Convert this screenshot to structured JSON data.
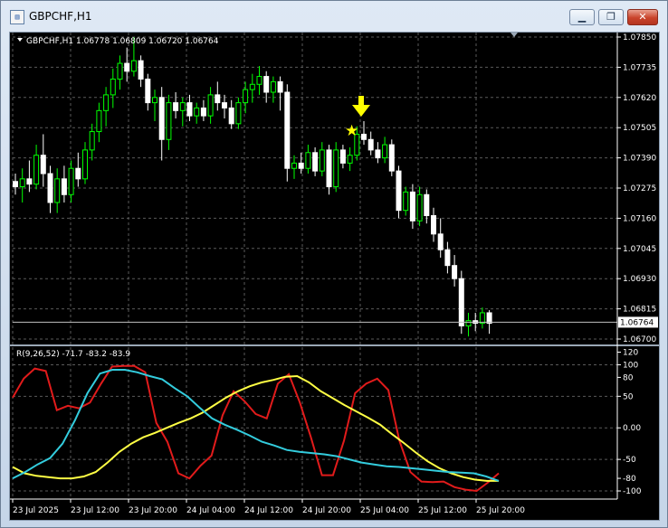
{
  "window": {
    "title": "GBPCHF,H1"
  },
  "chart": {
    "header": "GBPCHF,H1  1.06778 1.06809 1.06720 1.06764",
    "price_labels": [
      "1.07850",
      "1.07735",
      "1.07620",
      "1.07505",
      "1.07390",
      "1.07275",
      "1.07160",
      "1.07045",
      "1.06930",
      "1.06815",
      "1.06700"
    ],
    "current_price": "1.06764",
    "colors": {
      "background": "#000000",
      "bull": "#00ff00",
      "bear": "#ffffff",
      "arrow": "#ffff00",
      "star": "#ffff00"
    }
  },
  "indicator": {
    "header": "R(9,26,52) -71.7 -83.2 -83.9",
    "scale_labels": [
      "120",
      "100",
      "80",
      "50",
      "0.00",
      "-50",
      "-80",
      "-100"
    ],
    "colors": {
      "fast": "#e11b1b",
      "mid": "#ffff44",
      "slow": "#33ccdd"
    }
  },
  "time_labels": [
    "23 Jul 2025",
    "23 Jul 12:00",
    "23 Jul 20:00",
    "24 Jul 04:00",
    "24 Jul 12:00",
    "24 Jul 20:00",
    "25 Jul 04:00",
    "25 Jul 12:00",
    "25 Jul 20:00"
  ],
  "chart_data": {
    "type": "candlestick",
    "symbol": "GBPCHF",
    "timeframe": "H1",
    "ylim": [
      1.067,
      1.0785
    ],
    "candles": [
      [
        1.073,
        1.0733,
        1.0725,
        1.0728
      ],
      [
        1.0728,
        1.0735,
        1.0722,
        1.0731
      ],
      [
        1.0731,
        1.0738,
        1.0726,
        1.0729
      ],
      [
        1.0729,
        1.0744,
        1.0727,
        1.074
      ],
      [
        1.074,
        1.0748,
        1.0728,
        1.0733
      ],
      [
        1.0733,
        1.0736,
        1.0718,
        1.0722
      ],
      [
        1.0722,
        1.0735,
        1.0718,
        1.0731
      ],
      [
        1.0731,
        1.0736,
        1.0722,
        1.0725
      ],
      [
        1.0725,
        1.0738,
        1.0722,
        1.0735
      ],
      [
        1.0735,
        1.0741,
        1.0728,
        1.0731
      ],
      [
        1.0731,
        1.0745,
        1.0729,
        1.0742
      ],
      [
        1.0742,
        1.0752,
        1.0738,
        1.0749
      ],
      [
        1.0749,
        1.076,
        1.0745,
        1.0757
      ],
      [
        1.0757,
        1.0766,
        1.0751,
        1.0763
      ],
      [
        1.0763,
        1.0773,
        1.0758,
        1.0769
      ],
      [
        1.0769,
        1.0778,
        1.0765,
        1.0775
      ],
      [
        1.0775,
        1.0781,
        1.0768,
        1.0772
      ],
      [
        1.0772,
        1.0785,
        1.077,
        1.0776
      ],
      [
        1.0776,
        1.0778,
        1.0766,
        1.0769
      ],
      [
        1.0769,
        1.0771,
        1.0757,
        1.076
      ],
      [
        1.076,
        1.0765,
        1.0753,
        1.0762
      ],
      [
        1.0762,
        1.0766,
        1.0738,
        1.0746
      ],
      [
        1.0746,
        1.0763,
        1.0742,
        1.076
      ],
      [
        1.076,
        1.0764,
        1.0754,
        1.0757
      ],
      [
        1.0757,
        1.0762,
        1.0751,
        1.076
      ],
      [
        1.076,
        1.0763,
        1.0753,
        1.0755
      ],
      [
        1.0755,
        1.076,
        1.0752,
        1.0758
      ],
      [
        1.0758,
        1.0761,
        1.0753,
        1.0755
      ],
      [
        1.0755,
        1.0766,
        1.0752,
        1.0763
      ],
      [
        1.0763,
        1.0768,
        1.0757,
        1.076
      ],
      [
        1.076,
        1.0763,
        1.0754,
        1.0758
      ],
      [
        1.0758,
        1.0761,
        1.075,
        1.0752
      ],
      [
        1.0752,
        1.0762,
        1.075,
        1.076
      ],
      [
        1.076,
        1.0768,
        1.0756,
        1.0765
      ],
      [
        1.0765,
        1.0771,
        1.076,
        1.0767
      ],
      [
        1.0767,
        1.0774,
        1.0763,
        1.077
      ],
      [
        1.077,
        1.0772,
        1.076,
        1.0764
      ],
      [
        1.0764,
        1.077,
        1.076,
        1.0768
      ],
      [
        1.0768,
        1.077,
        1.0757,
        1.0764
      ],
      [
        1.0764,
        1.0767,
        1.073,
        1.0735
      ],
      [
        1.0735,
        1.074,
        1.0731,
        1.0737
      ],
      [
        1.0737,
        1.0741,
        1.0733,
        1.0735
      ],
      [
        1.0735,
        1.0744,
        1.0733,
        1.0741
      ],
      [
        1.0741,
        1.0743,
        1.0732,
        1.0734
      ],
      [
        1.0734,
        1.0745,
        1.0732,
        1.0742
      ],
      [
        1.0742,
        1.0744,
        1.0725,
        1.0728
      ],
      [
        1.0728,
        1.0745,
        1.0726,
        1.0742
      ],
      [
        1.0742,
        1.0744,
        1.0735,
        1.0737
      ],
      [
        1.0737,
        1.0743,
        1.0734,
        1.074
      ],
      [
        1.074,
        1.0751,
        1.0738,
        1.0748
      ],
      [
        1.0748,
        1.0753,
        1.0744,
        1.0746
      ],
      [
        1.0746,
        1.0749,
        1.074,
        1.0742
      ],
      [
        1.0742,
        1.0745,
        1.0737,
        1.0739
      ],
      [
        1.0739,
        1.0747,
        1.0737,
        1.0744
      ],
      [
        1.0744,
        1.0746,
        1.0732,
        1.0734
      ],
      [
        1.0734,
        1.0736,
        1.0716,
        1.0719
      ],
      [
        1.0719,
        1.0728,
        1.0717,
        1.0726
      ],
      [
        1.0726,
        1.0729,
        1.0712,
        1.0715
      ],
      [
        1.0715,
        1.0728,
        1.0713,
        1.0725
      ],
      [
        1.0725,
        1.0727,
        1.0714,
        1.0717
      ],
      [
        1.0717,
        1.072,
        1.0707,
        1.071
      ],
      [
        1.071,
        1.0716,
        1.0701,
        1.0704
      ],
      [
        1.0704,
        1.0707,
        1.0695,
        1.0698
      ],
      [
        1.0698,
        1.0702,
        1.069,
        1.0693
      ],
      [
        1.0693,
        1.0696,
        1.0672,
        1.0675
      ],
      [
        1.0675,
        1.068,
        1.0671,
        1.0677
      ],
      [
        1.0677,
        1.068,
        1.0673,
        1.0676
      ],
      [
        1.0676,
        1.0682,
        1.0674,
        1.068
      ],
      [
        1.068,
        1.0681,
        1.0672,
        1.0676
      ]
    ],
    "indicator": {
      "name": "R(9,26,52)",
      "ylim": [
        -110,
        125
      ],
      "series": [
        {
          "name": "9",
          "values": [
            48,
            78,
            94,
            90,
            28,
            35,
            31,
            40,
            70,
            97,
            98,
            98,
            88,
            8,
            -22,
            -72,
            -80,
            -60,
            -44,
            20,
            58,
            42,
            22,
            15,
            70,
            85,
            40,
            -15,
            -75,
            -75,
            -20,
            55,
            70,
            78,
            60,
            -20,
            -70,
            -85,
            -86,
            -85,
            -94,
            -98,
            -100,
            -87,
            -72
          ]
        },
        {
          "name": "26",
          "values": [
            -62,
            -72,
            -76,
            -78,
            -80,
            -80,
            -77,
            -70,
            -55,
            -38,
            -25,
            -15,
            -8,
            0,
            8,
            15,
            24,
            36,
            48,
            58,
            66,
            72,
            76,
            81,
            82,
            72,
            58,
            47,
            36,
            26,
            16,
            5,
            -10,
            -24,
            -39,
            -53,
            -64,
            -72,
            -78,
            -82,
            -84,
            -84
          ]
        },
        {
          "name": "52",
          "values": [
            -80,
            -70,
            -58,
            -48,
            -25,
            12,
            55,
            86,
            92,
            92,
            88,
            82,
            77,
            63,
            50,
            32,
            15,
            5,
            -3,
            -12,
            -22,
            -28,
            -35,
            -38,
            -40,
            -42,
            -45,
            -50,
            -55,
            -58,
            -61,
            -62,
            -64,
            -66,
            -68,
            -70,
            -71,
            -72,
            -77,
            -84
          ]
        }
      ]
    }
  }
}
